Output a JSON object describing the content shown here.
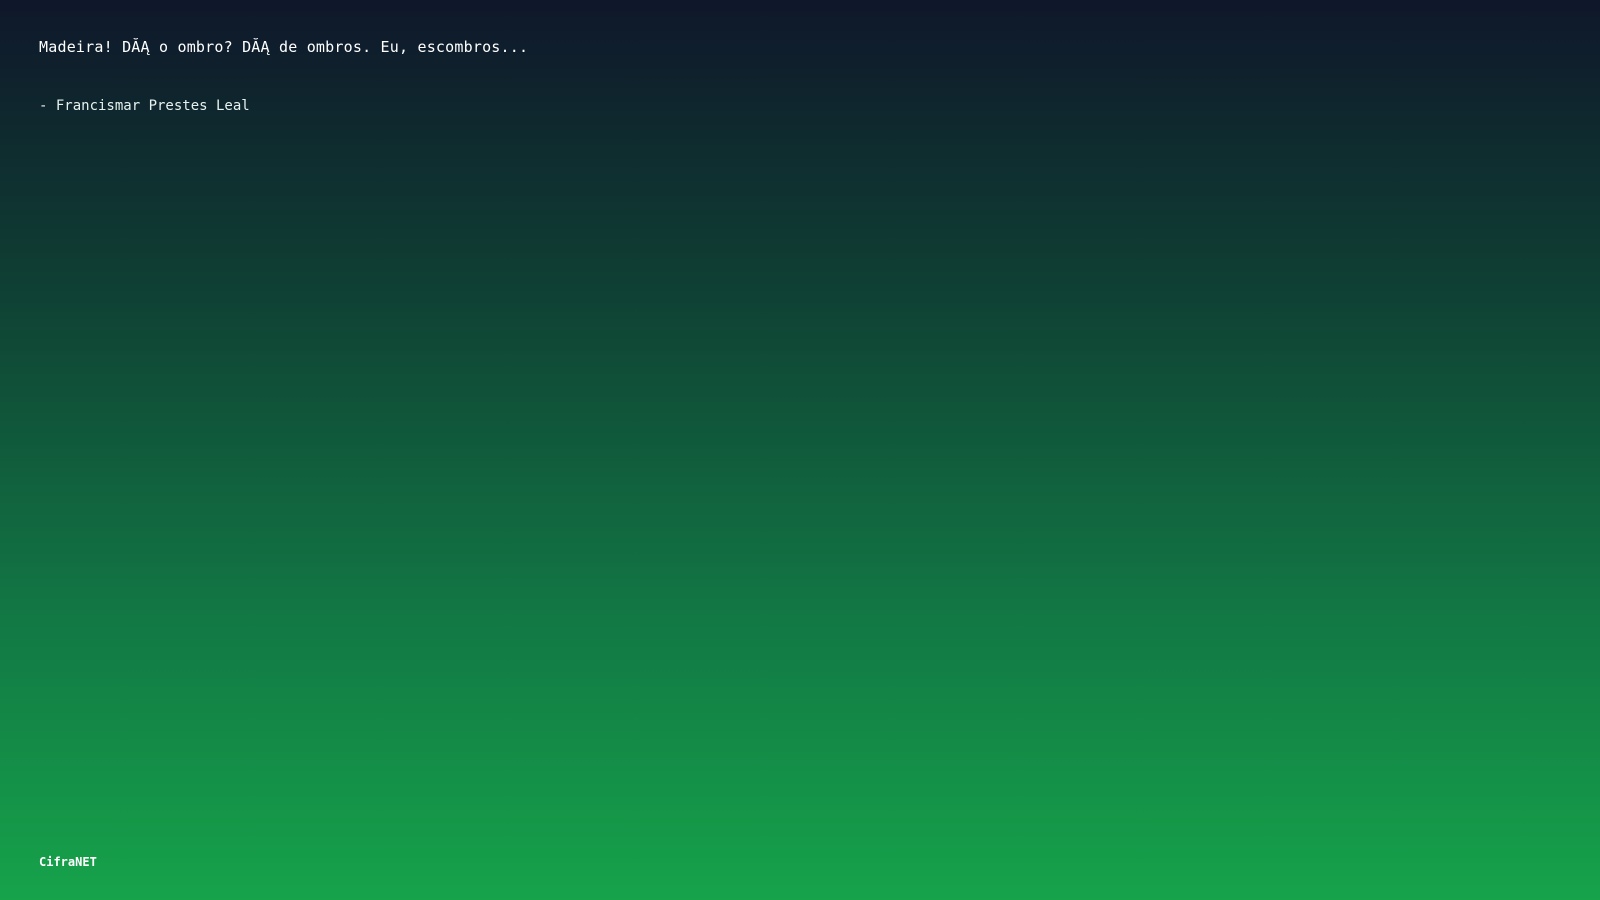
{
  "quote": {
    "text": "Madeira! DĂĄ o ombro? DĂĄ de ombros. Eu, escombros...",
    "author": "- Francismar Prestes Leal"
  },
  "footer": {
    "brand": "CifraNET"
  },
  "colors": {
    "gradient_top": "#0f172a",
    "gradient_bottom": "#16a34a",
    "text": "#ffffff"
  }
}
